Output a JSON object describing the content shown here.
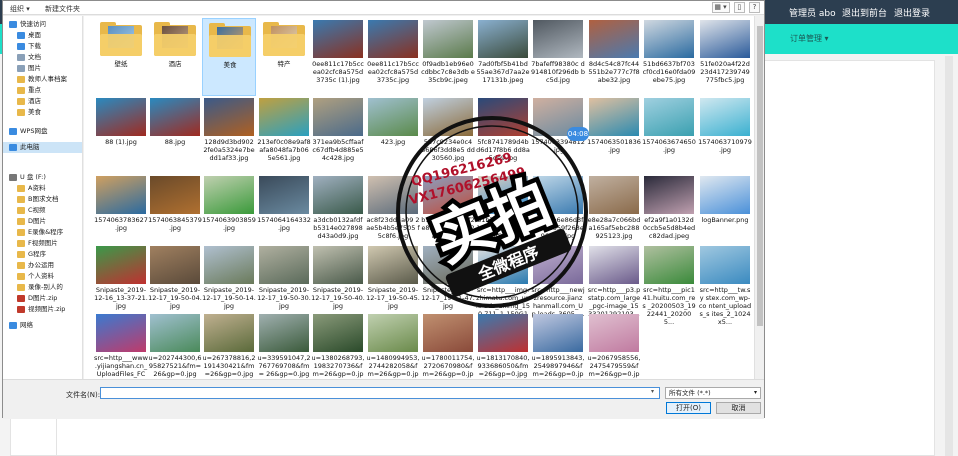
{
  "background_page": {
    "admin_label": "管理员 abo",
    "back_link": "退出到前台",
    "logout_link": "退出登录",
    "nav_item": "订单管理 ▾",
    "colors": {
      "topbar": "#2c3e50",
      "navbar": "#1de0c9"
    }
  },
  "toolbar": {
    "organize": "组织 ▾",
    "new_folder": "新建文件夹"
  },
  "window_controls": {
    "view": "▦ ▾",
    "pane": "▯",
    "help": "?"
  },
  "nav_pane": {
    "items": [
      {
        "label": "快速访问",
        "icon": "star-icon",
        "color": "#3a8be0"
      },
      {
        "label": "桌面",
        "icon": "desktop-icon",
        "color": "#3a8be0"
      },
      {
        "label": "下载",
        "icon": "download-icon",
        "color": "#3a8be0"
      },
      {
        "label": "文档",
        "icon": "document-icon",
        "color": "#8aa0b8"
      },
      {
        "label": "图片",
        "icon": "picture-icon",
        "color": "#8aa0b8"
      },
      {
        "label": "教师人事档案",
        "icon": "folder-icon",
        "color": "#e8b84a"
      },
      {
        "label": "重点",
        "icon": "folder-icon",
        "color": "#e8b84a"
      },
      {
        "label": "酒店",
        "icon": "folder-icon",
        "color": "#e8b84a"
      },
      {
        "label": "美食",
        "icon": "folder-icon",
        "color": "#e8b84a"
      },
      {
        "label": "WPS网盘",
        "icon": "cloud-icon",
        "color": "#3a8be0"
      },
      {
        "label": "此电脑",
        "icon": "computer-icon",
        "color": "#3a8be0"
      },
      {
        "label": "U 盘 (F:)",
        "icon": "usb-drive-icon",
        "color": "#777777"
      },
      {
        "label": "A资料",
        "icon": "folder-icon",
        "color": "#e8b84a"
      },
      {
        "label": "B图求文档",
        "icon": "folder-icon",
        "color": "#e8b84a"
      },
      {
        "label": "C视频",
        "icon": "folder-icon",
        "color": "#e8b84a"
      },
      {
        "label": "D图片",
        "icon": "folder-icon",
        "color": "#e8b84a"
      },
      {
        "label": "E录像&程序",
        "icon": "folder-icon",
        "color": "#e8b84a"
      },
      {
        "label": "F视频图片",
        "icon": "folder-icon",
        "color": "#e8b84a"
      },
      {
        "label": "G程序",
        "icon": "folder-icon",
        "color": "#e8b84a"
      },
      {
        "label": "办公运用",
        "icon": "folder-icon",
        "color": "#e8b84a"
      },
      {
        "label": "个人资料",
        "icon": "folder-icon",
        "color": "#e8b84a"
      },
      {
        "label": "录像-别人的",
        "icon": "folder-icon",
        "color": "#e8b84a"
      },
      {
        "label": "D图片.zip",
        "icon": "zip-icon",
        "color": "#c0392b"
      },
      {
        "label": "视频图片.zip",
        "icon": "zip-icon",
        "color": "#c0392b"
      },
      {
        "label": "网络",
        "icon": "network-icon",
        "color": "#3a8be0"
      }
    ]
  },
  "files": [
    {
      "name": "壁纸",
      "kind": "folder",
      "c1": "#5a8fc0",
      "c2": "#a0c8e8"
    },
    {
      "name": "酒店",
      "kind": "folder",
      "c1": "#6a5040",
      "c2": "#c0a080"
    },
    {
      "name": "美食",
      "kind": "folder",
      "c1": "#3a6ea0",
      "c2": "#d0a060",
      "selected": true
    },
    {
      "name": "特产",
      "kind": "folder",
      "c1": "#c09060",
      "c2": "#e0d0b0"
    },
    {
      "name": "0ee811c17b5cc ea02cfc8a575d 3735c (1).jpg",
      "kind": "image",
      "c1": "#8a3020",
      "c2": "#3a7ab0"
    },
    {
      "name": "0ee811c17b5cc ea02cfc8a575d 3735c.jpg",
      "kind": "image",
      "c1": "#8a3020",
      "c2": "#3a7ab0"
    },
    {
      "name": "0f9adb1eb96e0 cdbbc7c8e3db e35cb9c.jpeg",
      "kind": "image",
      "c1": "#5a7a4a",
      "c2": "#c0c8d0"
    },
    {
      "name": "7ad0fbf5b41bd 55ae367d7aa2e 17131b.jpeg",
      "kind": "image",
      "c1": "#3a4a3a",
      "c2": "#8ab0d0"
    },
    {
      "name": "7bafeff98380c d914810f296db bc5d.jpg",
      "kind": "image",
      "c1": "#b0b8c0",
      "c2": "#505860"
    },
    {
      "name": "8d4c54c87fc44 551b2e777c7f8 abe32.jpg",
      "kind": "image",
      "c1": "#4a7ab0",
      "c2": "#b06040"
    },
    {
      "name": "51bd6637bf703 cf0cd16e0fda09 ebe75.jpg",
      "kind": "image",
      "c1": "#2a6aa0",
      "c2": "#d0d8e0"
    },
    {
      "name": "51fe020a4f22d 23d417239749 775fbc5.jpg",
      "kind": "image",
      "c1": "#2a5a9a",
      "c2": "#e0e4ea"
    },
    {
      "name": "88 (1).jpg",
      "kind": "image",
      "c1": "#a02a20",
      "c2": "#2a8ac0"
    },
    {
      "name": "88.jpg",
      "kind": "image",
      "c1": "#a02a20",
      "c2": "#2a8ac0"
    },
    {
      "name": "128d9d3bd902 2fe0a5324e7be dd1af33.jpg",
      "kind": "image",
      "c1": "#b06020",
      "c2": "#3a5a8a"
    },
    {
      "name": "213ef0c08e9af8 afa8048fa7b06 5e561.jpg",
      "kind": "image",
      "c1": "#2aa0c0",
      "c2": "#c0a040"
    },
    {
      "name": "371ea9b5cffaaf c67dfb4d885e5 4c428.jpg",
      "kind": "image",
      "c1": "#4a6a8a",
      "c2": "#b0a080"
    },
    {
      "name": "423.jpg",
      "kind": "image",
      "c1": "#5a8a4a",
      "c2": "#a0c0d0"
    },
    {
      "name": "537c9234e0c4 8686f3dd8e5 dd30560.jpg",
      "kind": "image",
      "c1": "#8a6a3a",
      "c2": "#c0d0e0"
    },
    {
      "name": "5fc8741789d4b d6d17f8b6 dd8a 5de9.jpg",
      "kind": "image",
      "c1": "#b04030",
      "c2": "#2a4a7a"
    },
    {
      "name": "1574063394812 .jpg",
      "kind": "image",
      "c1": "#6a8aa0",
      "c2": "#d0b0a0"
    },
    {
      "name": "1574063501836 .jpg",
      "kind": "image",
      "c1": "#2a8ab0",
      "c2": "#e0c0a0"
    },
    {
      "name": "1574063674650 .jpg",
      "kind": "image",
      "c1": "#3aa0b0",
      "c2": "#a0d0e0"
    },
    {
      "name": "1574063710979 .jpg",
      "kind": "image",
      "c1": "#3ab0d0",
      "c2": "#d0e8f0"
    },
    {
      "name": "1574063783627 .jpg",
      "kind": "image",
      "c1": "#2a6aa0",
      "c2": "#d0a060"
    },
    {
      "name": "1574063845379 .jpg",
      "kind": "image",
      "c1": "#b07030",
      "c2": "#6a4a2a"
    },
    {
      "name": "1574063903859 .jpg",
      "kind": "image",
      "c1": "#3a9a3a",
      "c2": "#c0d0b0"
    },
    {
      "name": "1574064164332 .jpg",
      "kind": "image",
      "c1": "#6a8aa0",
      "c2": "#3a4a5a"
    },
    {
      "name": "a3dcb0132afdf b5314e027898 d43a0d9.jpg",
      "kind": "image",
      "c1": "#3a5a4a",
      "c2": "#a0b0c0"
    },
    {
      "name": "ac8f23dd5a09 2ae5b4b5e7505 f5c8f6.jpg",
      "kind": "image",
      "c1": "#5a6a7a",
      "c2": "#d0c0b0"
    },
    {
      "name": "b1f05ae4bfc2 f2e8b1f95a0c d02ab6e0.jpg",
      "kind": "image",
      "c1": "#c04a3a",
      "c2": "#8aa0c0"
    },
    {
      "name": "b1b7f59d8b8ed 1a29da27bd9d2 8e489f.jpg",
      "kind": "image",
      "c1": "#2a8ad0",
      "c2": "#e0d0c0"
    },
    {
      "name": "ced48e6e86d3f 32e04959f268e 962fc2.jpg",
      "kind": "image",
      "c1": "#3a7ab0",
      "c2": "#c0d8e8"
    },
    {
      "name": "e8e28a7c066bd a165af5ebc288 925123.jpg",
      "kind": "image",
      "c1": "#8a6a4a",
      "c2": "#c0b0a0"
    },
    {
      "name": "ef2a9f1a0132d 0ccb5e5d8b4ed c82dad.jpeg",
      "kind": "image",
      "c1": "#c0a0b0",
      "c2": "#2a2a3a"
    },
    {
      "name": "logBanner.png",
      "kind": "image",
      "c1": "#4a90d9",
      "c2": "#e0e8f0"
    },
    {
      "name": "Snipaste_2019-12-16_13-37-21.jpg",
      "kind": "image",
      "c1": "#c03030",
      "c2": "#3a9a4a"
    },
    {
      "name": "Snipaste_2019-12-17_19-50-04.jpg",
      "kind": "image",
      "c1": "#5a4a3a",
      "c2": "#a08060"
    },
    {
      "name": "Snipaste_2019-12-17_19-50-14.jpg",
      "kind": "image",
      "c1": "#6a7a5a",
      "c2": "#b0c0d0"
    },
    {
      "name": "Snipaste_2019-12-17_19-50-30.jpg",
      "kind": "image",
      "c1": "#5a6a5a",
      "c2": "#b0b0a0"
    },
    {
      "name": "Snipaste_2019-12-17_19-50-40.jpg",
      "kind": "image",
      "c1": "#4a5a4a",
      "c2": "#c0c0b0"
    },
    {
      "name": "Snipaste_2019-12-17_19-50-45.jpg",
      "kind": "image",
      "c1": "#5a5a4a",
      "c2": "#d0c8b0"
    },
    {
      "name": "Snipaste_2019-12-17_19-51-47.jpg",
      "kind": "image",
      "c1": "#6a6a5a",
      "c2": "#a0b0c0"
    },
    {
      "name": "src=http___img. zhimatu.com_uplo ads_allimg_150 711_1-150G11...",
      "kind": "image",
      "c1": "#2a7ab0",
      "c2": "#e0e0e0"
    },
    {
      "name": "src=http___newj zresource.jianz hanmall.com_Up loads_3605_...",
      "kind": "image",
      "c1": "#7a6a9a",
      "c2": "#c0b0d0"
    },
    {
      "name": "src=http___p3.p statp.com_large _pgc-image_15 33201292103...",
      "kind": "image",
      "c1": "#6a5a8a",
      "c2": "#e0e0e8"
    },
    {
      "name": "src=http___pic1 41.huitu.com_res _20200503_19 22441_202005...",
      "kind": "image",
      "c1": "#3a8a3a",
      "c2": "#b0c0a0"
    },
    {
      "name": "src=http___tw.sy stex.com_wp-co ntent_uploads_s ites_2_1024x5...",
      "kind": "image",
      "c1": "#3a8ac0",
      "c2": "#a0c8e0"
    },
    {
      "name": "src=http___www .yijiangshan.cn_ UploadFiles_FC K_image005(1...",
      "kind": "image",
      "c1": "#c03a6a",
      "c2": "#3a7ad0"
    },
    {
      "name": "u=202744300,6 95827521&fm= 26&gp=0.jpg",
      "kind": "image",
      "c1": "#4a8a5a",
      "c2": "#a0c0d0"
    },
    {
      "name": "u=267378816,2 191430421&fm =26&gp=0.jpg",
      "kind": "image",
      "c1": "#5a6a3a",
      "c2": "#c0b090"
    },
    {
      "name": "u=339591047,2 767769708&fm= 26&gp=0.jpg",
      "kind": "image",
      "c1": "#3a5a3a",
      "c2": "#a0b0b0"
    },
    {
      "name": "u=1380268793, 1983270736&f m=26&gp=0.jp g",
      "kind": "image",
      "c1": "#2a4a2a",
      "c2": "#8a9a7a"
    },
    {
      "name": "u=1480994953, 2744282058&f m=26&gp=0.jp g",
      "kind": "image",
      "c1": "#6a8a4a",
      "c2": "#c0d0b0"
    },
    {
      "name": "u=1780011754, 2720670980&f m=26&gp=0.jp g",
      "kind": "image",
      "c1": "#8a4a3a",
      "c2": "#c09070"
    },
    {
      "name": "u=1813170840, 933686050&fm =26&gp=0.jpg",
      "kind": "image",
      "c1": "#c03030",
      "c2": "#3a7ab0"
    },
    {
      "name": "u=1895913843, 2549897946&f m=26&gp=0.jp g",
      "kind": "image",
      "c1": "#3a6aa0",
      "c2": "#c0c8e0"
    },
    {
      "name": "u=2067958556, 2475479559&f m=26&gp=0.jp g",
      "kind": "image",
      "c1": "#c07aa0",
      "c2": "#e0c0d0"
    }
  ],
  "bottom_bar": {
    "filename_label": "文件名(N):",
    "filename_value": "",
    "filetype_value": "所有文件 (*.*)",
    "open_button": "打开(O)",
    "cancel_button": "取消"
  },
  "overlay": {
    "qq": "QQ196216269",
    "vx": "VX17606256499",
    "big_text": "实拍",
    "sub_text": "全微程序",
    "badge": "04:08"
  }
}
